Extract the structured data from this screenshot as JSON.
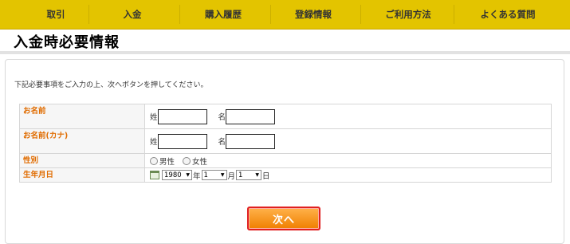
{
  "nav": {
    "items": [
      {
        "label": "取引"
      },
      {
        "label": "入金"
      },
      {
        "label": "購入履歴"
      },
      {
        "label": "登録情報"
      },
      {
        "label": "ご利用方法"
      },
      {
        "label": "よくある質問"
      }
    ]
  },
  "page": {
    "title": "入金時必要情報",
    "intro": "下記必要事項をご入力の上、次へボタンを押してください。"
  },
  "form": {
    "name": {
      "label": "お名前",
      "sei": "姓",
      "mei": "名",
      "sei_value": "",
      "mei_value": ""
    },
    "kana": {
      "label": "お名前(カナ)",
      "sei": "姓",
      "mei": "名",
      "sei_value": "",
      "mei_value": ""
    },
    "gender": {
      "label": "性別",
      "options": [
        "男性",
        "女性"
      ],
      "selected": ""
    },
    "birth": {
      "label": "生年月日",
      "year": "1980",
      "year_unit": "年",
      "month": "1",
      "month_unit": "月",
      "day": "1",
      "day_unit": "日"
    }
  },
  "buttons": {
    "next": "次へ"
  },
  "colors": {
    "nav_bg": "#e3c400",
    "label_text": "#e06c00",
    "button": "#f07f00",
    "highlight": "#e02020"
  }
}
